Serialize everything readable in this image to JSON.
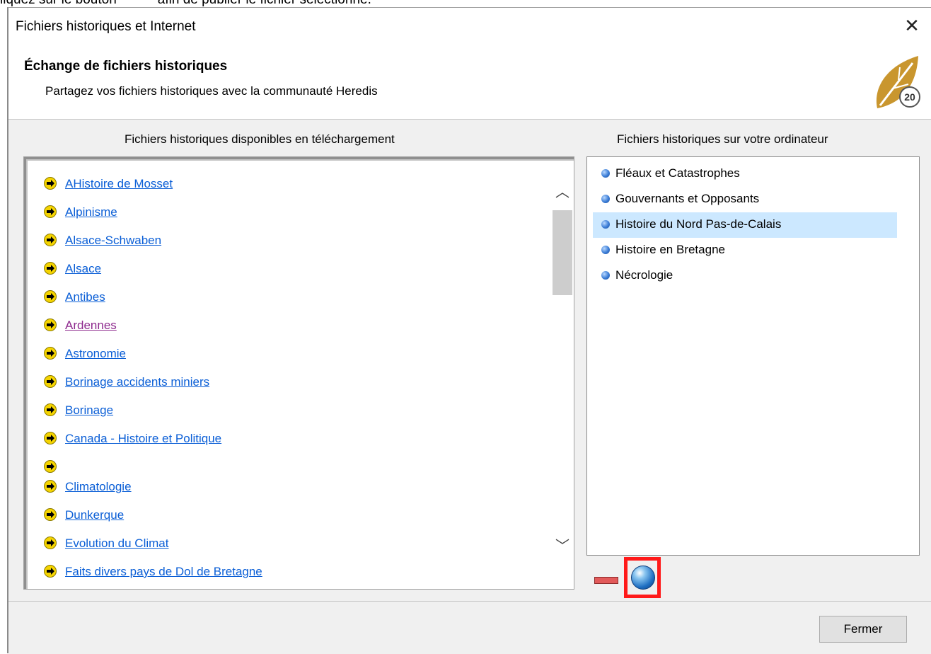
{
  "caption": {
    "before": "liquez sur le bouton",
    "after": "afin de publier le fichier sélectionné."
  },
  "window": {
    "title": "Fichiers historiques et Internet",
    "close_glyph": "✕"
  },
  "header": {
    "title": "Échange de fichiers historiques",
    "subtitle": "Partagez vos fichiers historiques avec la communauté Heredis",
    "logo_text": "20"
  },
  "left_panel": {
    "label": "Fichiers historiques disponibles en téléchargement",
    "items": [
      {
        "label": "AHistoire de Mosset"
      },
      {
        "label": "Alpinisme"
      },
      {
        "label": "Alsace-Schwaben"
      },
      {
        "label": "Alsace"
      },
      {
        "label": "Antibes"
      },
      {
        "label": "Ardennes",
        "visited": true
      },
      {
        "label": "Astronomie"
      },
      {
        "label": "Borinage accidents miniers"
      },
      {
        "label": "Borinage"
      },
      {
        "label": "Canada - Histoire et Politique"
      },
      {
        "label": ""
      },
      {
        "label": "Climatologie"
      },
      {
        "label": "Dunkerque"
      },
      {
        "label": "Evolution du Climat"
      },
      {
        "label": "Faits divers pays de Dol de Bretagne"
      }
    ],
    "scroll_up_glyph": "︿",
    "scroll_down_glyph": "﹀"
  },
  "right_panel": {
    "label": "Fichiers historiques sur votre ordinateur",
    "items": [
      {
        "label": "Fléaux et Catastrophes"
      },
      {
        "label": "Gouvernants et Opposants"
      },
      {
        "label": "Histoire du Nord Pas-de-Calais",
        "selected": true
      },
      {
        "label": "Histoire en Bretagne"
      },
      {
        "label": "Nécrologie"
      }
    ]
  },
  "footer": {
    "close_label": "Fermer"
  },
  "colors": {
    "link": "#0a5ed6",
    "visited_link": "#8e2a8e",
    "selection": "#cce8ff",
    "highlight_box": "#ff1a1a",
    "logo_gold": "#c9962e"
  },
  "icons": {
    "item_icon": "arrow-right-circle-icon",
    "bullet_icon": "blue-bullet-icon",
    "publish_icon": "globe-icon"
  }
}
